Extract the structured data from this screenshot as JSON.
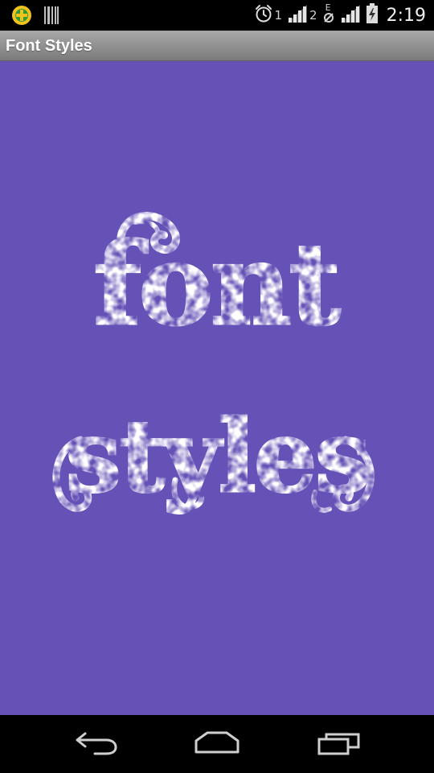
{
  "status_bar": {
    "left_icons": [
      "app-notification-icon",
      "barcode-notification-icon"
    ],
    "alarm_icon": "alarm-clock-icon",
    "sim1_label": "1",
    "sim2_label": "2",
    "data_indicator": "E",
    "time": "2:19"
  },
  "action_bar": {
    "title": "Font Styles"
  },
  "main": {
    "background_color": "#6651b6",
    "logo_line1": "font",
    "logo_line2": "styles"
  },
  "nav_bar": {
    "icons": [
      "back-icon",
      "home-icon",
      "recent-apps-icon"
    ]
  }
}
